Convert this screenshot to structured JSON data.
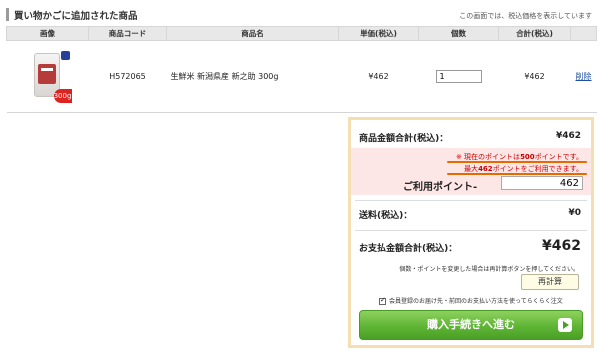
{
  "section": {
    "title": "買い物かごに追加された商品",
    "note": "この画面では、税込価格を表示しています"
  },
  "table": {
    "headers": [
      "画像",
      "商品コード",
      "商品名",
      "単価(税込)",
      "個数",
      "合計(税込)",
      ""
    ],
    "rows": [
      {
        "image_badge": "300g",
        "code": "H572065",
        "name": "生鮮米 新潟県産 新之助 300g",
        "unit_price": "¥462",
        "quantity": "1",
        "total": "¥462",
        "delete_label": "削除"
      }
    ]
  },
  "summary": {
    "subtotal_label": "商品金額合計(税込)：",
    "subtotal_value": "¥462",
    "points_note1_prefix": "※ 現在のポイントは",
    "points_note1_value": "500",
    "points_note1_suffix": "ポイントです。",
    "points_note2_prefix": "最大",
    "points_note2_value": "462",
    "points_note2_suffix": "ポイントをご利用できます。",
    "use_points_label": "ご利用ポイント-",
    "use_points_value": "462",
    "shipping_label": "送料(税込)：",
    "shipping_value": "¥0",
    "total_label": "お支払金額合計(税込)：",
    "total_value": "¥462",
    "recalc_note": "個数・ポイントを変更した場合は再計算ボタンを押してください。",
    "recalc_button": "再計算",
    "remember_label": "会員登録のお届け先・前回のお支払い方法を使ってらくらく注文",
    "proceed_button": "購入手続きへ進む"
  }
}
